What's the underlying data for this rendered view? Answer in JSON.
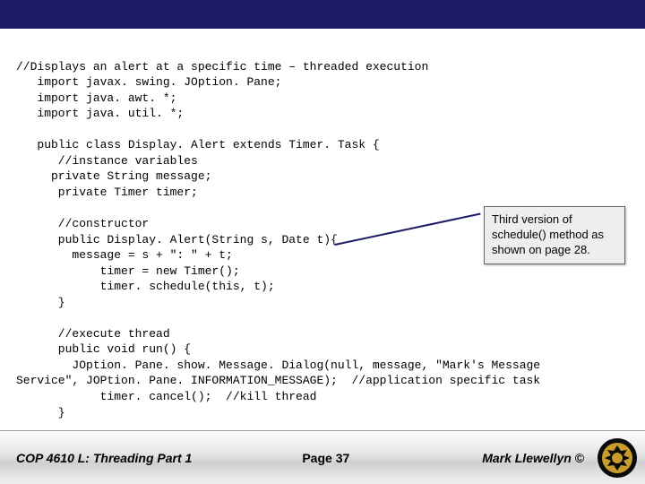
{
  "code": {
    "comment_top": "//Displays an alert at a specific time – threaded execution",
    "import1": "   import javax. swing. JOption. Pane;",
    "import2": "   import java. awt. *;",
    "import3": "   import java. util. *;",
    "class_decl": "   public class Display. Alert extends Timer. Task {",
    "inst_comment": "      //instance variables",
    "field1": "     private String message;",
    "field2": "      private Timer timer;",
    "ctor_comment": "      //constructor",
    "ctor_sig": "      public Display. Alert(String s, Date t){",
    "ctor_l1": "        message = s + \": \" + t;",
    "ctor_l2": "            timer = new Timer();",
    "ctor_l3": "            timer. schedule(this, t);",
    "ctor_close": "      }",
    "exec_comment": "      //execute thread",
    "run_sig": "      public void run() {",
    "run_l1": "        JOption. Pane. show. Message. Dialog(null, message, \"Mark's Message",
    "run_l2": "Service\", JOPtion. Pane. INFORMATION_MESSAGE);  //application specific task",
    "run_l3": "            timer. cancel();  //kill thread",
    "run_close": "      }"
  },
  "callout": {
    "text": "Third version of schedule() method as shown on page 28."
  },
  "footer": {
    "left": "COP 4610 L: Threading Part 1",
    "mid": "Page 37",
    "right": "Mark Llewellyn ©"
  }
}
